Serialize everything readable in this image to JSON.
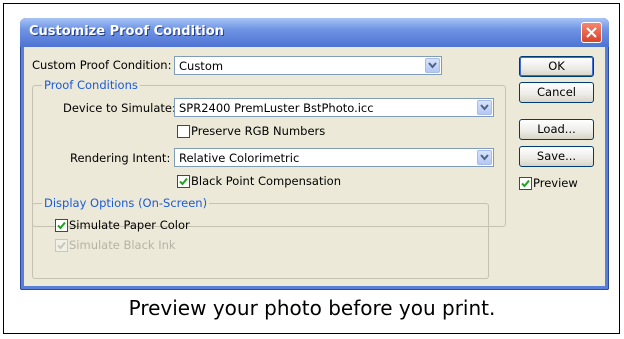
{
  "dialog": {
    "title": "Customize Proof Condition",
    "custom_proof_label": "Custom Proof Condition:",
    "custom_proof_value": "Custom"
  },
  "proof_conditions": {
    "group_title": "Proof Conditions",
    "device_label": "Device to Simulate:",
    "device_value": "SPR2400 PremLuster BstPhoto.icc",
    "preserve_rgb_label": "Preserve RGB Numbers",
    "preserve_rgb_checked": false,
    "rendering_label": "Rendering Intent:",
    "rendering_value": "Relative Colorimetric",
    "black_point_label": "Black Point Compensation",
    "black_point_checked": true
  },
  "display_options": {
    "group_title": "Display Options (On-Screen)",
    "simulate_paper_label": "Simulate Paper Color",
    "simulate_paper_checked": true,
    "simulate_ink_label": "Simulate Black Ink",
    "simulate_ink_checked": true,
    "simulate_ink_enabled": false
  },
  "buttons": {
    "ok": "OK",
    "cancel": "Cancel",
    "load": "Load...",
    "save": "Save...",
    "preview_label": "Preview",
    "preview_checked": true
  },
  "caption": "Preview your photo before you print.",
  "colors": {
    "title_bar": "#4e74d3",
    "dialog_bg": "#ece9d8",
    "group_title": "#1b5bd6",
    "close_button": "#d8442a"
  }
}
